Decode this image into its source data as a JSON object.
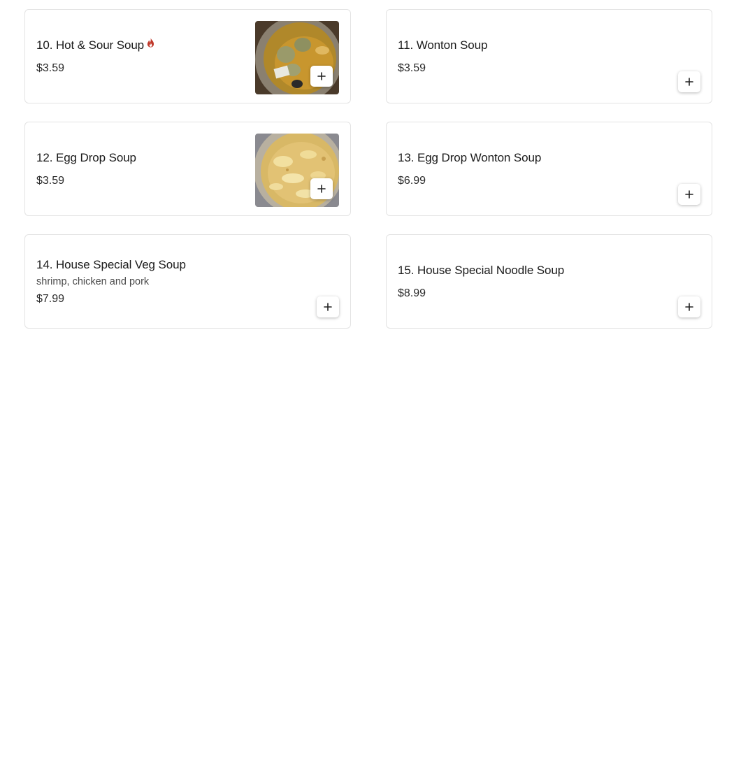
{
  "menu": {
    "items": [
      {
        "name": "10. Hot & Sour Soup",
        "price": "$3.59",
        "description": "",
        "spicy": true,
        "image": "hot-sour-soup-photo"
      },
      {
        "name": "11. Wonton Soup",
        "price": "$3.59",
        "description": "",
        "spicy": false,
        "image": ""
      },
      {
        "name": "12. Egg Drop Soup",
        "price": "$3.59",
        "description": "",
        "spicy": false,
        "image": "egg-drop-soup-photo"
      },
      {
        "name": "13. Egg Drop Wonton Soup",
        "price": "$6.99",
        "description": "",
        "spicy": false,
        "image": ""
      },
      {
        "name": "14. House Special Veg Soup",
        "price": "$7.99",
        "description": "shrimp, chicken and pork",
        "spicy": false,
        "image": ""
      },
      {
        "name": "15. House Special Noodle Soup",
        "price": "$8.99",
        "description": "",
        "spicy": false,
        "image": ""
      }
    ]
  },
  "icons": {
    "spicy": "fire-icon",
    "add": "plus-icon"
  },
  "colors": {
    "spicy": "#c0392b",
    "border": "#e3e3e3",
    "text": "#1a1a1a"
  }
}
